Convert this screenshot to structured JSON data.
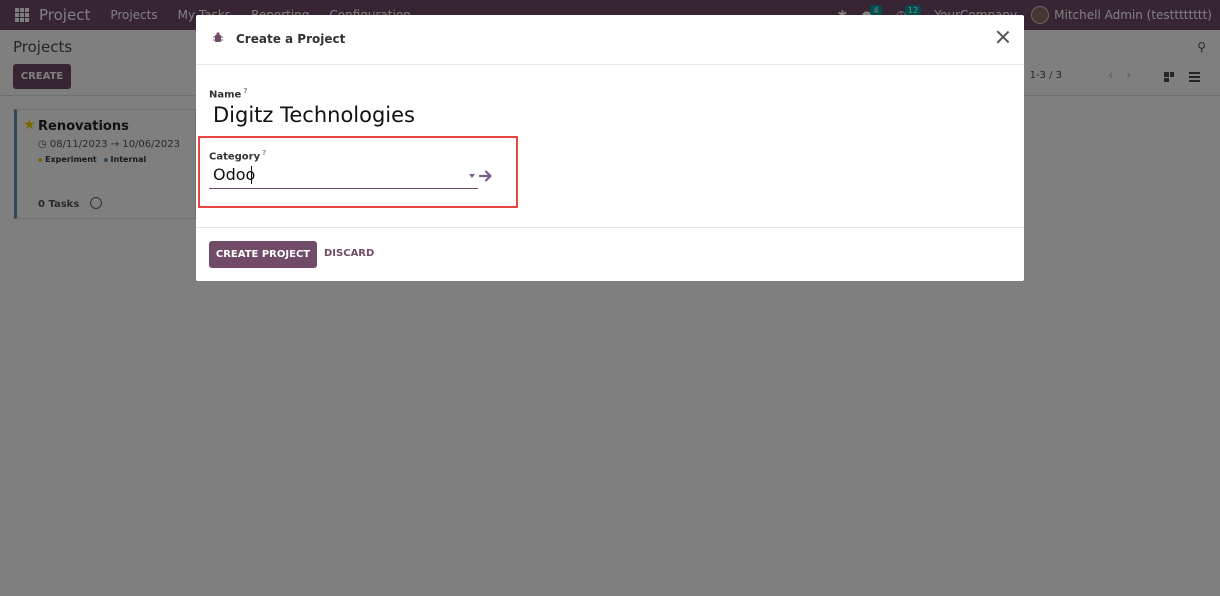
{
  "navbar": {
    "app_name": "Project",
    "menus": [
      "Projects",
      "My Tasks",
      "Reporting",
      "Configuration"
    ],
    "messages_count": "4",
    "activities_count": "12",
    "company": "YourCompany",
    "user": "Mitchell Admin (testttttttt)"
  },
  "control_panel": {
    "breadcrumb": "Projects",
    "create_label": "CREATE",
    "pager": "1-3 / 3"
  },
  "card": {
    "title": "Renovations",
    "date_start": "08/11/2023",
    "date_arrow": "→",
    "date_end": "10/06/2023",
    "tags": [
      {
        "label": "Experiment",
        "color": "#f3cc00"
      },
      {
        "label": "Internal",
        "color": "#5b8fb9"
      }
    ],
    "tasks": "0 Tasks"
  },
  "modal": {
    "title": "Create a Project",
    "name_label": "Name",
    "name_help": "?",
    "name_value": "Digitz Technologies",
    "category_label": "Category",
    "category_help": "?",
    "category_value": "Odoo",
    "create_button": "CREATE PROJECT",
    "discard_button": "DISCARD"
  },
  "colors": {
    "brand": "#714b67",
    "highlight": "#e4473d"
  }
}
